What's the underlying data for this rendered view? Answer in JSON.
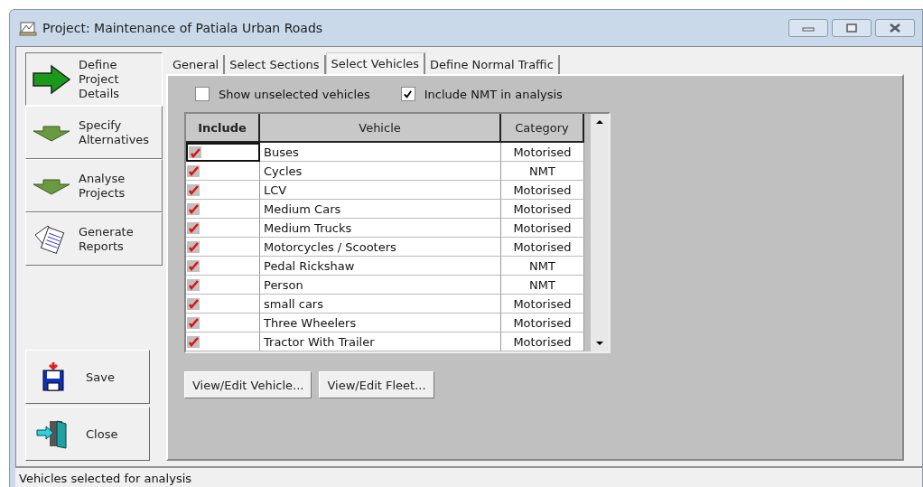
{
  "window": {
    "title": "Project: Maintenance of Patiala Urban Roads"
  },
  "sidebar": {
    "items": [
      {
        "kind": "arrow-right",
        "label": "Define Project Details",
        "selected": true
      },
      {
        "kind": "arrow-down",
        "label": "Specify Alternatives",
        "selected": false
      },
      {
        "kind": "arrow-down",
        "label": "Analyse Projects",
        "selected": false
      },
      {
        "kind": "report",
        "label": "Generate Reports",
        "selected": false
      }
    ],
    "buttons": [
      {
        "kind": "save",
        "label": "Save"
      },
      {
        "kind": "close",
        "label": "Close"
      }
    ]
  },
  "tabs": [
    {
      "label": "General",
      "selected": false
    },
    {
      "label": "Select Sections",
      "selected": false
    },
    {
      "label": "Select Vehicles",
      "selected": true
    },
    {
      "label": "Define Normal Traffic",
      "selected": false
    }
  ],
  "options": [
    {
      "label": "Show unselected vehicles",
      "checked": false
    },
    {
      "label": "Include NMT in analysis",
      "checked": true
    }
  ],
  "table": {
    "columns": [
      "Include",
      "Vehicle",
      "Category"
    ],
    "rows": [
      {
        "include": true,
        "vehicle": "Buses",
        "category": "Motorised"
      },
      {
        "include": true,
        "vehicle": "Cycles",
        "category": "NMT"
      },
      {
        "include": true,
        "vehicle": "LCV",
        "category": "Motorised"
      },
      {
        "include": true,
        "vehicle": "Medium Cars",
        "category": "Motorised"
      },
      {
        "include": true,
        "vehicle": "Medium Trucks",
        "category": "Motorised"
      },
      {
        "include": true,
        "vehicle": "Motorcycles / Scooters",
        "category": "Motorised"
      },
      {
        "include": true,
        "vehicle": "Pedal Rickshaw",
        "category": "NMT"
      },
      {
        "include": true,
        "vehicle": "Person",
        "category": "NMT"
      },
      {
        "include": true,
        "vehicle": "small cars",
        "category": "Motorised"
      },
      {
        "include": true,
        "vehicle": "Three Wheelers",
        "category": "Motorised"
      },
      {
        "include": true,
        "vehicle": "Tractor With Trailer",
        "category": "Motorised"
      }
    ]
  },
  "actions": [
    "View/Edit Vehicle...",
    "View/Edit Fleet..."
  ],
  "status_bar": "Vehicles selected for analysis"
}
